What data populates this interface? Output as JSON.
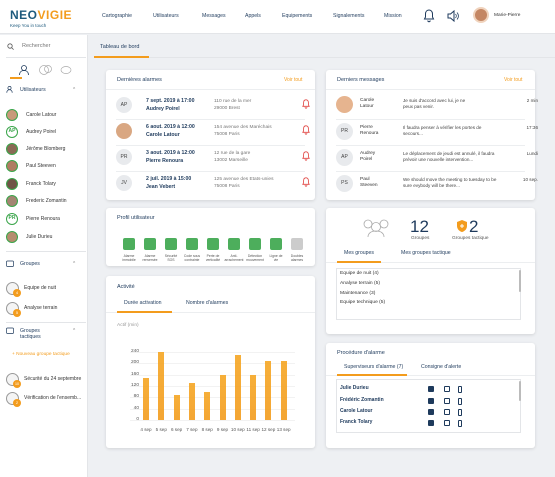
{
  "brand": {
    "name_a": "NEO",
    "name_b": "VIGIE",
    "tagline": "Keep You in touch"
  },
  "nav": [
    "Cartographie",
    "Utilisateurs",
    "Messages",
    "Appels",
    "Equipements",
    "Signalements",
    "Mission"
  ],
  "user": {
    "name": "Marie-Pierre"
  },
  "sidebar": {
    "search_placeholder": "Rechercher",
    "users_title": "Utilisateurs",
    "users": [
      "Carole Latour",
      "Audrey Poirel",
      "Jérôme Blomberg",
      "Paul Steeven",
      "Franck Tolary",
      "Frederic Zomantin",
      "Pierre Renoura",
      "Julie Durieu"
    ],
    "user_badges": [
      "",
      "AP",
      "",
      "",
      "",
      "",
      "PR",
      ""
    ],
    "groups_title": "Groupes",
    "groups": [
      {
        "label": "Equipe de nuit",
        "badge": "4"
      },
      {
        "label": "Analyse terrain",
        "badge": "5"
      }
    ],
    "tactical_title": "Groupes tactiques",
    "new_tactical": "+ Nouveau groupe tactique",
    "tactical": [
      {
        "label": "Sécurité du 24 septembre",
        "badge": "10"
      },
      {
        "label": "Vérification de l'ensemb...",
        "badge": "2"
      }
    ]
  },
  "page_tab": "Tableau de bord",
  "alarms": {
    "title": "Dernières alarmes",
    "see_all": "Voir tout",
    "items": [
      {
        "initials": "AP",
        "date": "7 sept. 2019 à 17:00",
        "name": "Audrey Poirel",
        "address": "110 rue de la mer\n29000 Brest"
      },
      {
        "initials": "",
        "date": "6 aout. 2019 à 12:00",
        "name": "Carole Latour",
        "address": "154 avenue des Maréchais\n75008 Paris"
      },
      {
        "initials": "PR",
        "date": "3 aout. 2019 à 12:00",
        "name": "Pierre Renoura",
        "address": "12 rue de la gare\n13002 Marseille"
      },
      {
        "initials": "JV",
        "date": "2 juil. 2019 à 15:00",
        "name": "Jean Vebert",
        "address": "125 avenue des Etats-unies\n75008 Paris"
      }
    ]
  },
  "messages": {
    "title": "Derniers messages",
    "see_all": "Voir tout",
    "items": [
      {
        "initials": "",
        "name": "Carole\nLatour",
        "text": "Je suis d'accord avec lui, je ne\npeux pas venir.",
        "time": "2 min"
      },
      {
        "initials": "PR",
        "name": "Pierre\nRenoura",
        "text": "Il faudra penser à vérifier les portes de\nsecours...",
        "time": "17:36"
      },
      {
        "initials": "AP",
        "name": "Audrey\nPoirel",
        "text": "Le déplacement de jeudi est annulé, il faudra\nprévoir une nouvelle intervention...",
        "time": "Lundi"
      },
      {
        "initials": "PS",
        "name": "Paul\nSteeven",
        "text": "We should move the meeting to tuesday to be\nsure evybody will be there...",
        "time": "10 sep."
      }
    ]
  },
  "profile": {
    "title": "Profil utilisateur",
    "items": [
      "Alarme\nimmobile",
      "Alarme\nrenversée",
      "Sécurité\nSOS",
      "Code sous\ncontrainte",
      "Perte de\nverticalité",
      "Anti-\narrachement",
      "Détection\nmouvement",
      "Ligne de\nvie",
      "Doubles\nalarmes"
    ]
  },
  "groups_card": {
    "count": "12",
    "count_label": "Groupes",
    "tact_count": "2",
    "tact_label": "Groupes tactique",
    "tab1": "Mes groupes",
    "tab2": "Mes groupes tactique",
    "items": [
      "Equipe de nuit (4)",
      "Analyse terrain (5)",
      "Maintenance (3)",
      "Equipe technique (5)"
    ]
  },
  "activity": {
    "title": "Activité",
    "tab1": "Durée activation",
    "tab2": "Nombre d'alarmes",
    "unit": "Actif (min)"
  },
  "chart_data": {
    "type": "bar",
    "categories": [
      "4 sep",
      "5 sep",
      "6 sep",
      "7 sep",
      "8 sep",
      "9 sep",
      "10 sep",
      "11 sep",
      "12 sep",
      "13 sep"
    ],
    "values": [
      150,
      240,
      90,
      130,
      100,
      160,
      230,
      160,
      210,
      210
    ],
    "ylabel": "Actif (min)",
    "ylim": [
      0,
      240
    ],
    "yticks": [
      0,
      40,
      80,
      120,
      160,
      200,
      240
    ]
  },
  "procedure": {
    "title": "Procédure d'alarme",
    "tab1": "Superviseurs d'alarme (7)",
    "tab2": "Consigne d'alerte",
    "people": [
      "Julie Durieu",
      "Frédéric Zomantin",
      "Carole Latour",
      "Franck Tolary"
    ]
  }
}
